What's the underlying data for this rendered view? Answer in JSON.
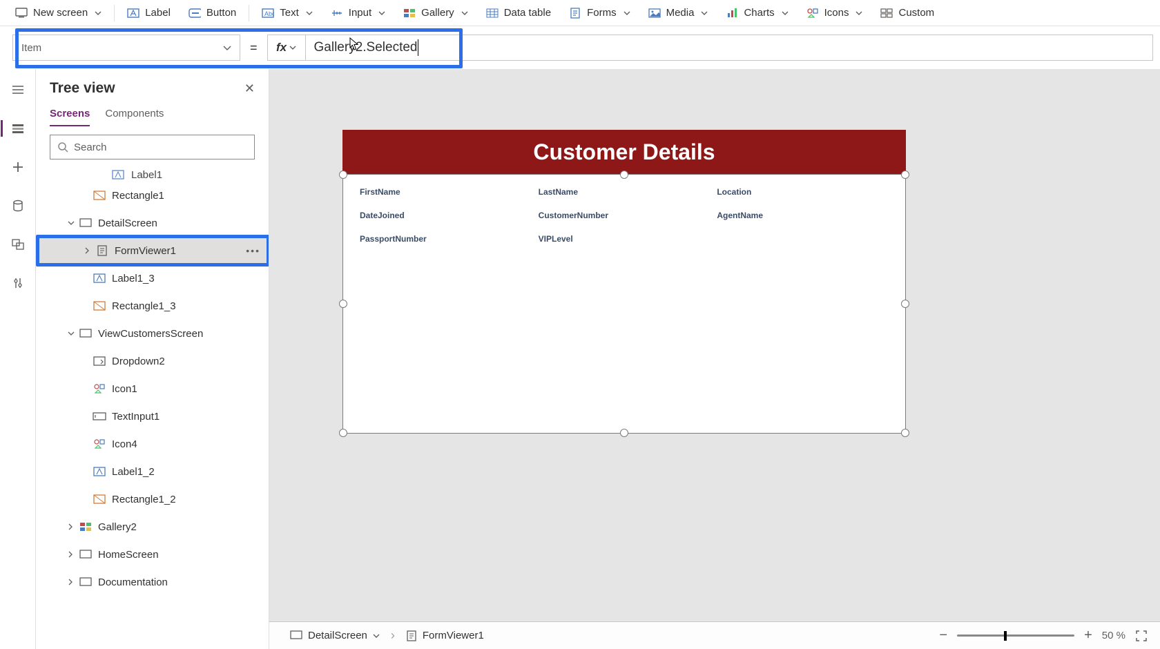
{
  "ribbon": {
    "new_screen": "New screen",
    "label": "Label",
    "button": "Button",
    "text": "Text",
    "input": "Input",
    "gallery": "Gallery",
    "data_table": "Data table",
    "forms": "Forms",
    "media": "Media",
    "charts": "Charts",
    "icons": "Icons",
    "custom": "Custom"
  },
  "formula_bar": {
    "property": "Item",
    "expr": "Gallery2.Selected"
  },
  "tree": {
    "title": "Tree view",
    "tab_screens": "Screens",
    "tab_components": "Components",
    "search_placeholder": "Search",
    "cutoff_item_label": "Label1",
    "items": [
      {
        "label": "Rectangle1",
        "icon": "rect",
        "indent": 106
      },
      {
        "label": "DetailScreen",
        "icon": "screen",
        "indent": 86,
        "chev": "down"
      },
      {
        "label": "FormViewer1",
        "icon": "form",
        "indent": 110,
        "chev": "right",
        "selected": true,
        "highlight": true,
        "dots": true
      },
      {
        "label": "Label1_3",
        "icon": "label",
        "indent": 106
      },
      {
        "label": "Rectangle1_3",
        "icon": "rect",
        "indent": 106
      },
      {
        "label": "ViewCustomersScreen",
        "icon": "screen",
        "indent": 86,
        "chev": "down"
      },
      {
        "label": "Dropdown2",
        "icon": "dropdown",
        "indent": 106
      },
      {
        "label": "Icon1",
        "icon": "iconc",
        "indent": 106
      },
      {
        "label": "TextInput1",
        "icon": "textinput",
        "indent": 106
      },
      {
        "label": "Icon4",
        "icon": "iconc",
        "indent": 106
      },
      {
        "label": "Label1_2",
        "icon": "label",
        "indent": 106
      },
      {
        "label": "Rectangle1_2",
        "icon": "rect",
        "indent": 106
      },
      {
        "label": "Gallery2",
        "icon": "gallery",
        "indent": 86,
        "chev": "right"
      },
      {
        "label": "HomeScreen",
        "icon": "screen",
        "indent": 86,
        "chev": "right"
      },
      {
        "label": "Documentation",
        "icon": "screen",
        "indent": 86,
        "chev": "right"
      }
    ]
  },
  "canvas": {
    "title": "Customer Details",
    "fields": [
      "FirstName",
      "LastName",
      "Location",
      "DateJoined",
      "CustomerNumber",
      "AgentName",
      "PassportNumber",
      "VIPLevel"
    ]
  },
  "breadcrumb": {
    "screen": "DetailScreen",
    "control": "FormViewer1"
  },
  "zoom": {
    "value": "50",
    "unit": "%"
  }
}
